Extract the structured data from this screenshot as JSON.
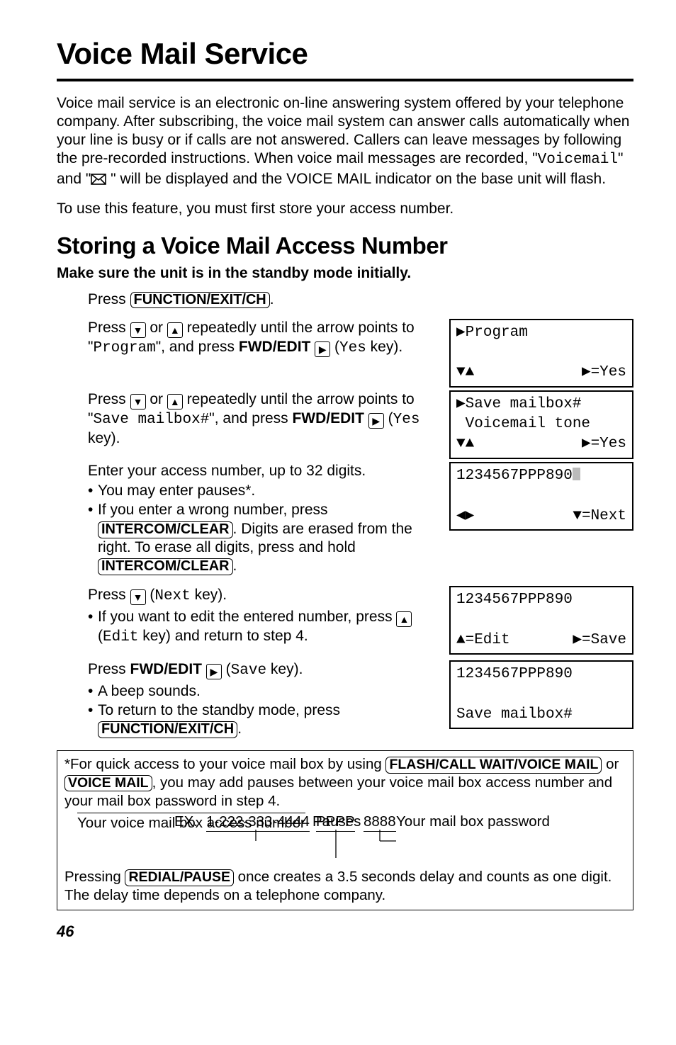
{
  "title": "Voice Mail Service",
  "intro1a": "Voice mail service is an electronic on-line answering system offered by your telephone company. After subscribing, the voice mail system can answer calls automatically when your line is busy or if calls are not answered. Callers can leave messages by following the pre-recorded instructions. When voice mail messages are recorded, \"",
  "intro1_voicemail": "Voicemail",
  "intro1b": "\" and \"",
  "intro1c": " \" will be displayed and the VOICE MAIL indicator on the base unit will flash.",
  "intro2": "To use this feature, you must first store your access number.",
  "heading2": "Storing a Voice Mail Access Number",
  "standby": "Make sure the unit is in the standby mode initially.",
  "step1_pre": "Press ",
  "key_function": "FUNCTION/EXIT/CH",
  "step1_post": ".",
  "step2a": "Press ",
  "step2b": " or ",
  "step2c": " repeatedly until the arrow points to \"",
  "step2_program": "Program",
  "step2d": "\", and press ",
  "step2_fwd": "FWD/EDIT",
  "step2e": " (",
  "step2_yes": "Yes",
  "step2f": " key).",
  "step3a": "Press ",
  "step3b": " or ",
  "step3c": " repeatedly until the arrow points to \"",
  "step3_save": "Save mailbox#",
  "step3d": "\", and press ",
  "step3_fwd": "FWD/EDIT",
  "step3e": " (",
  "step3_yes": "Yes",
  "step3f": " key).",
  "step4_main": "Enter your access number, up to 32 digits.",
  "step4_b1": "You may enter pauses*.",
  "step4_b2a": "If you enter a wrong number, press ",
  "key_intercom": "INTERCOM/CLEAR",
  "step4_b2b": ". Digits are erased from the right. To erase all digits, press and hold ",
  "step4_b2c": ".",
  "step5a": "Press ",
  "step5b": " (",
  "step5_next": "Next",
  "step5c": " key).",
  "step5_b1a": "If you want to edit the entered number, press ",
  "step5_b1b": " (",
  "step5_edit": "Edit",
  "step5_b1c": " key) and return to step 4.",
  "step6a": "Press ",
  "step6_fwd": "FWD/EDIT",
  "step6b": " (",
  "step6_save": "Save",
  "step6c": " key).",
  "step6_b1": "A beep sounds.",
  "step6_b2a": "To return to the standby mode, press ",
  "step6_b2b": ".",
  "screen_program_l1": "▶Program",
  "screen_program_l2l": "▼▲",
  "screen_program_l2r": "▶=Yes",
  "screen_save_l1": "▶Save mailbox#",
  "screen_save_l2": " Voicemail tone",
  "screen_save_l3l": "▼▲",
  "screen_save_l3r": "▶=Yes",
  "screen_num_l1": "1234567PPP890",
  "screen_num_l2l": "◀▶",
  "screen_num_l2r": "▼=Next",
  "screen_edit_l1": "1234567PPP890",
  "screen_edit_l2l": "▲=Edit",
  "screen_edit_l2r": "▶=Save",
  "screen_final_l1": "1234567PPP890",
  "screen_final_l2": "Save mailbox#",
  "foot1a": "*For quick access to your voice mail box by using ",
  "key_flash": "FLASH/CALL WAIT/VOICE MAIL",
  "foot1b": " or ",
  "key_voicemail": "VOICE MAIL",
  "foot1c": ", you may add pauses between your voice mail box access number and your mail box password in step 4.",
  "ex_label": "EX. ",
  "ex_num": "1-222-333-4444",
  "ex_pppp": "PPPP",
  "ex_pwd": "8888",
  "ex_access": "Your voice mail box access number",
  "ex_password": "Your mail box password",
  "ex_pauses": "Pauses",
  "foot2a": "Pressing ",
  "key_redial": "REDIAL/PAUSE",
  "foot2b": " once creates a 3.5 seconds delay and counts as one digit. The delay time depends on a telephone company.",
  "page_num": "46"
}
